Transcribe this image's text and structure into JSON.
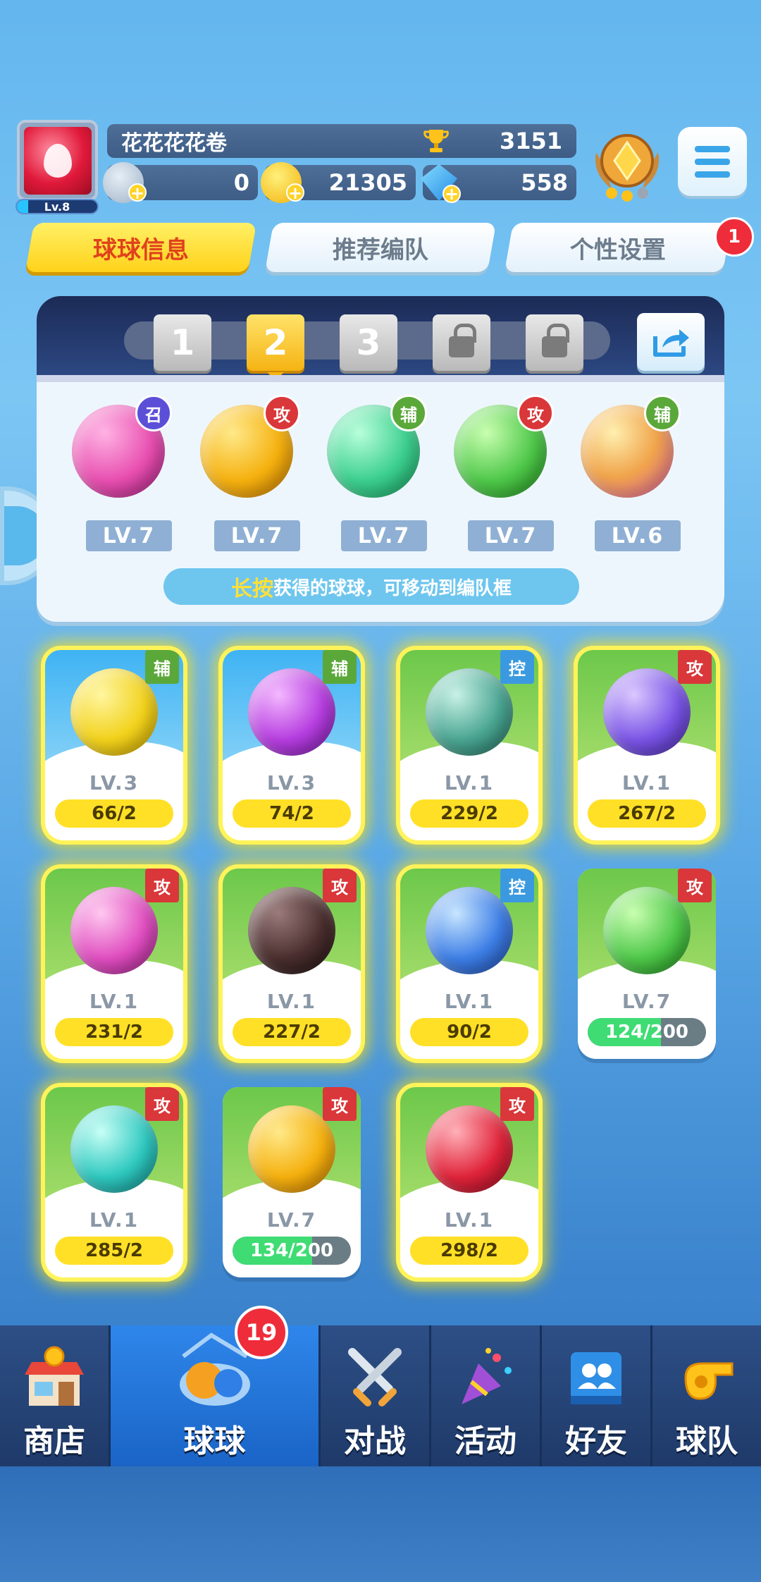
{
  "player": {
    "level": "Lv.8",
    "name": "花花花花卷",
    "trophies": "3151",
    "stars": "0",
    "coins": "21305",
    "diamonds": "558"
  },
  "tabs": [
    {
      "label": "球球信息"
    },
    {
      "label": "推荐编队"
    },
    {
      "label": "个性设置"
    }
  ],
  "tab_notification": "1",
  "team_slots": [
    "1",
    "2",
    "3"
  ],
  "team": [
    {
      "role": "召",
      "level": "LV.7",
      "color": "#e74fb0"
    },
    {
      "role": "攻",
      "level": "LV.7",
      "color": "#f5b10f"
    },
    {
      "role": "辅",
      "level": "LV.7",
      "color": "#3ccf8e"
    },
    {
      "role": "攻",
      "level": "LV.7",
      "color": "#4fc84a"
    },
    {
      "role": "辅",
      "level": "LV.6",
      "color": "#f0a44b"
    }
  ],
  "hint": {
    "highlight": "长按",
    "text": "获得的球球，可移动到编队框"
  },
  "balls": [
    {
      "type": "辅",
      "level": "LV.3",
      "progress": "66/2"
    },
    {
      "type": "辅",
      "level": "LV.3",
      "progress": "74/2"
    },
    {
      "type": "控",
      "level": "LV.1",
      "progress": "229/2"
    },
    {
      "type": "攻",
      "level": "LV.1",
      "progress": "267/2"
    },
    {
      "type": "攻",
      "level": "LV.1",
      "progress": "231/2"
    },
    {
      "type": "攻",
      "level": "LV.1",
      "progress": "227/2"
    },
    {
      "type": "控",
      "level": "LV.1",
      "progress": "90/2"
    },
    {
      "type": "攻",
      "level": "LV.7",
      "progress": "124/200",
      "fill": 0.62
    },
    {
      "type": "攻",
      "level": "LV.1",
      "progress": "285/2"
    },
    {
      "type": "攻",
      "level": "LV.7",
      "progress": "134/200",
      "fill": 0.67
    },
    {
      "type": "攻",
      "level": "LV.1",
      "progress": "298/2"
    }
  ],
  "nav": [
    {
      "label": "商店"
    },
    {
      "label": "球球",
      "badge": "19"
    },
    {
      "label": "对战"
    },
    {
      "label": "活动"
    },
    {
      "label": "好友"
    },
    {
      "label": "球队"
    }
  ]
}
